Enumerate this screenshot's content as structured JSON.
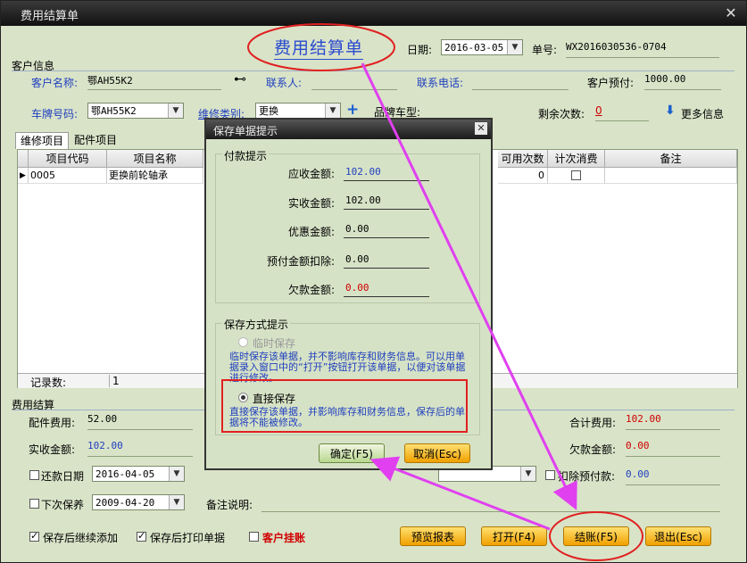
{
  "window": {
    "title": "费用结算单",
    "close": "✕"
  },
  "header": {
    "doc_title": "费用结算单",
    "date_label": "日期:",
    "date_value": "2016-03-05",
    "docno_label": "单号:",
    "docno_value": "WX2016030536-0704"
  },
  "customer": {
    "section": "客户信息",
    "name_label": "客户名称:",
    "name_value": "鄂AH55K2",
    "contact_label": "联系人:",
    "phone_label": "联系电话:",
    "prepay_label": "客户预付:",
    "prepay_value": "1000.00",
    "plate_label": "车牌号码:",
    "plate_value": "鄂AH55K2",
    "repair_label": "维修类别:",
    "repair_value": "更换",
    "model_label": "品牌车型:",
    "remain_label": "剩余次数:",
    "remain_value": "0",
    "more_label": "更多信息"
  },
  "tabs": [
    "维修项目",
    "配件项目"
  ],
  "grid": {
    "columns": [
      "项目代码",
      "项目名称",
      "可用次数",
      "计次消费",
      "备注"
    ],
    "rows": [
      {
        "code": "0005",
        "name": "更换前轮轴承",
        "times": "0"
      }
    ],
    "record_label": "记录数:",
    "record_count": "1"
  },
  "settle": {
    "section": "费用结算",
    "parts_label": "配件费用:",
    "parts_value": "52.00",
    "total_label": "合计费用:",
    "total_value": "102.00",
    "paid_label": "实收金额:",
    "paid_value": "102.00",
    "owe_label": "欠款金额:",
    "owe_value": "0.00",
    "repay_label": "还款日期",
    "repay_date": "2016-04-05",
    "deduct_label": "扣除预付款:",
    "deduct_value": "0.00",
    "next_label": "下次保养",
    "next_date": "2009-04-20",
    "remark_label": "备注说明:"
  },
  "bottom": {
    "continue_label": "保存后继续添加",
    "print_label": "保存后打印单据",
    "hang_label": "客户挂账",
    "preview_btn": "预览报表",
    "open_btn": "打开(F4)",
    "checkout_btn": "结账(F5)",
    "exit_btn": "退出(Esc)"
  },
  "dialog": {
    "title": "保存单据提示",
    "close": "✕",
    "pay_group": "付款提示",
    "receivable_label": "应收金额:",
    "receivable_value": "102.00",
    "received_label": "实收金额:",
    "received_value": "102.00",
    "discount_label": "优惠金额:",
    "discount_value": "0.00",
    "prepay_deduct_label": "预付金额扣除:",
    "prepay_deduct_value": "0.00",
    "debt_label": "欠款金额:",
    "debt_value": "0.00",
    "save_group": "保存方式提示",
    "temp_label": "临时保存",
    "temp_desc": "临时保存该单据，并不影响库存和财务信息。可以用单据录入窗口中的“打开”按钮打开该单据，以便对该单据进行修改。",
    "direct_label": "直接保存",
    "direct_desc": "直接保存该单据，并影响库存和财务信息，保存后的单据将不能被修改。",
    "ok_btn": "确定(F5)",
    "cancel_btn": "取消(Esc)"
  },
  "colors": {
    "annotation": "#e02020",
    "arrow": "#e040f0",
    "value_blue": "#1f3fbf",
    "value_red": "#d00000"
  }
}
